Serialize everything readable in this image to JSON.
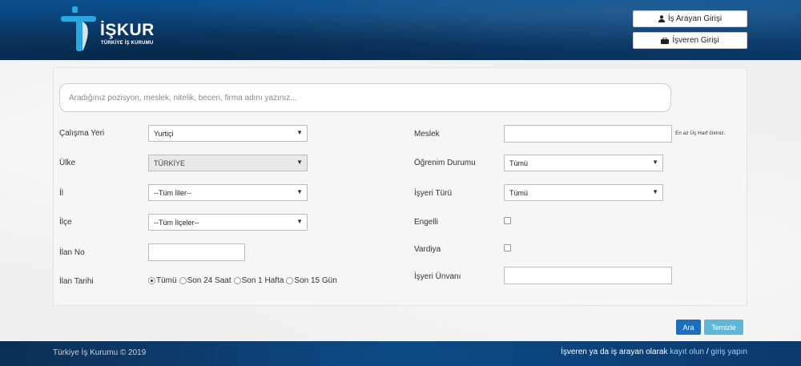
{
  "colors": {
    "header_bg": "#0b3f72",
    "footer_bg": "#0b3a6c",
    "primary_button": "#1d6fbd",
    "secondary_button": "#5fb7d8",
    "link": "#9fd0f2"
  },
  "header": {
    "logo": {
      "title": "İŞKUR",
      "subtitle": "TÜRKİYE İŞ KURUMU"
    },
    "job_seeker_login": {
      "label": "İş Arayan Girişi",
      "icon": "user-icon"
    },
    "employer_login": {
      "label": "İşveren Girişi",
      "icon": "briefcase-icon"
    }
  },
  "search": {
    "placeholder": "Aradığınız pozisyon, meslek, nitelik, beceri, firma adını yazınız..."
  },
  "left_fields": {
    "work_place": {
      "label": "Çalışma Yeri",
      "value": "Yurtiçi"
    },
    "country": {
      "label": "Ülke",
      "value": "TÜRKİYE"
    },
    "province": {
      "label": "İl",
      "value": "--Tüm İller--"
    },
    "district": {
      "label": "İlçe",
      "value": "--Tüm İlçeler--"
    },
    "ad_no": {
      "label": "İlan No",
      "value": ""
    },
    "ad_date": {
      "label": "İlan Tarihi",
      "options": [
        "Tümü",
        "Son 24 Saat",
        "Son 1 Hafta",
        "Son 15 Gün"
      ],
      "selected": "Tümü"
    }
  },
  "right_fields": {
    "occupation": {
      "label": "Meslek",
      "value": "",
      "hint": "En az Üç Harf Giriniz."
    },
    "education": {
      "label": "Öğrenim Durumu",
      "value": "Tümü"
    },
    "workplace_type": {
      "label": "İşyeri Türü",
      "value": "Tümü"
    },
    "disabled": {
      "label": "Engelli",
      "checked": false
    },
    "shift": {
      "label": "Vardiya",
      "checked": false
    },
    "workplace_title": {
      "label": "İşyeri Ünvanı",
      "value": ""
    }
  },
  "actions": {
    "search_label": "Ara",
    "clear_label": "Temizle"
  },
  "footer": {
    "copyright": "Türkiye İş Kurumu © 2019",
    "cta_prefix": "İşveren ya da iş arayan olarak ",
    "register_link": "kayıt olun",
    "separator": " / ",
    "login_link": "giriş yapın"
  }
}
